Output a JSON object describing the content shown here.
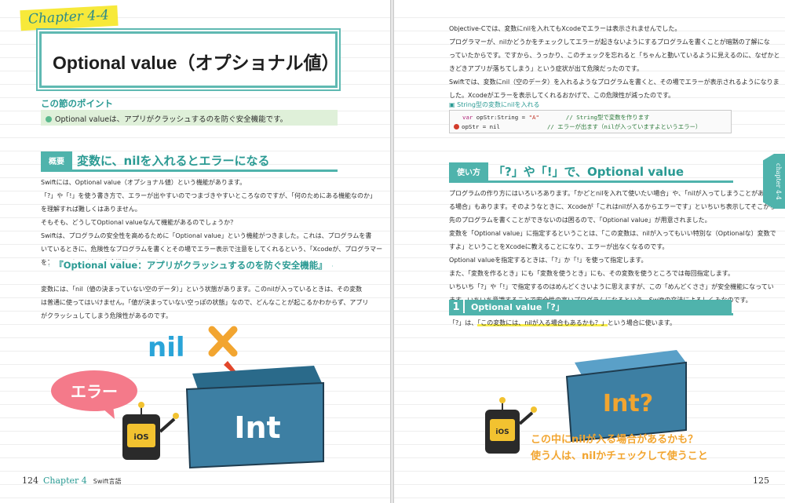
{
  "left_page": {
    "chapter_tag": "Chapter 4-4",
    "title": "Optional value（オプショナル値）",
    "point_heading": "この節のポイント",
    "point_text": "Optional valueは、アプリがクラッシュするのを防ぐ安全機能です。",
    "section": {
      "tag": "概要",
      "title": "変数に、nilを入れるとエラーになる"
    },
    "paragraphs": [
      "Swiftには、Optional value（オプショナル値）という機能があります。",
      "「?」や「!」を使う書き方で、エラーが出やすいのでつまづきやすいところなのですが、「何のためにある機能なのか」",
      "を理解すれば難しくはありません。",
      "そもそも、どうしてOptional valueなんて機能があるのでしょうか？",
      "Swiftは、プログラムの安全性を高めるために「Optional value」という機能がつきました。これは、プログラムを書",
      "いているときに、危険性なプログラムを書くとその場でエラー表示で注意をしてくれるという、「Xcodeが、プログラマー",
      "をアシストしてくれる安全機能」なのです。"
    ],
    "subheading": "『Optional value：アプリがクラッシュするのを防ぐ安全機能』",
    "paragraphs2": [
      "変数には、「nil（値の決まっていない空のデータ）」という状態があります。このnilが入っているときは、その変数",
      "は普通に使ってはいけません。「値が決まっていない空っぽの状態」なので、どんなことが起こるかわからず、アプリ",
      "がクラッシュしてしまう危険性があるのです。"
    ],
    "illustration": {
      "nil": "nil",
      "error": "エラー",
      "box": "Int",
      "robot": "iOS"
    },
    "footer": {
      "page": "124",
      "chapter": "Chapter 4",
      "name": "Swift言語"
    }
  },
  "right_page": {
    "paragraphs": [
      "Objective-Cでは、変数にnilを入れてもXcodeでエラーは表示されませんでした。",
      "プログラマーが、nilかどうかをチェックしてエラーが起きないようにするプログラムを書くことが暗黙の了解にな",
      "っていたからです。ですから、うっかり、このチェックを忘れると「ちゃんと動いているように見えるのに、なぜかと",
      "きどきアプリが落ちてしまう」という症状が出て危険だったのです。",
      "Swiftでは、変数にnil（空のデータ）を入れるようなプログラムを書くと、その場でエラーが表示されるようになりま",
      "した。Xcodeがエラーを表示してくれるおかげで、この危険性が減ったのです。"
    ],
    "code_caption": "String型の変数にnilを入れる",
    "code_lines": [
      {
        "kw": "var",
        "code": " opStr:String = ",
        "str": "\"A\"",
        "comment": "// String型で変数を作ります"
      },
      {
        "kw": "",
        "code": "opStr = nil",
        "str": "",
        "comment": "// エラーが出ます（nilが入っていますよというエラー）"
      }
    ],
    "section": {
      "tag": "使い方",
      "title": "「?」や「!」で、Optional value"
    },
    "paragraphs2": [
      "プログラムの作り方にはいろいろあります。「かどとnilを入れて使いたい場合」や、「nilが入ってしまうことがあ",
      "る場合」もあります。そのようなときに、Xcodeが「これはnilが入るからエラーです」といちいち表示してそこから",
      "先のプログラムを書くことができないのは困るので、「Optional value」が用意されました。",
      "変数を「Optional value」に指定するということは、「この変数は、nilが入ってもいい特別な（Optionalな）変数で",
      "すよ」ということをXcodeに教えることになり、エラーが出なくなるのです。",
      "Optional valueを指定するときは、「?」か「!」を使って指定します。",
      "また、「変数を作るとき」にも「変数を使うとき」にも、その変数を使うところでは毎回指定します。",
      "いちいち「?」や「!」で指定するのはめんどくさいように思えますが、この「めんどくささ」が安全機能になってい",
      "ます。いちいち意識することで安全性の高いプログラムになるという、Swiftの文法によるしくみなのです。"
    ],
    "numbered": {
      "num": "1",
      "title": "Optional value「?」"
    },
    "last_line_prefix": "「?」は、",
    "last_line_highlight": "「この変数には、nilが入る場合もあるかも？」",
    "last_line_suffix": "という場合に使います。",
    "illustration": {
      "box": "Int?",
      "robot": "iOS",
      "caption1": "この中にnilが入る場合があるかも？",
      "caption2": "使う人は、nilかチェックして使うこと"
    },
    "side_tab": "chapter 4-4",
    "footer": {
      "page": "125"
    }
  }
}
